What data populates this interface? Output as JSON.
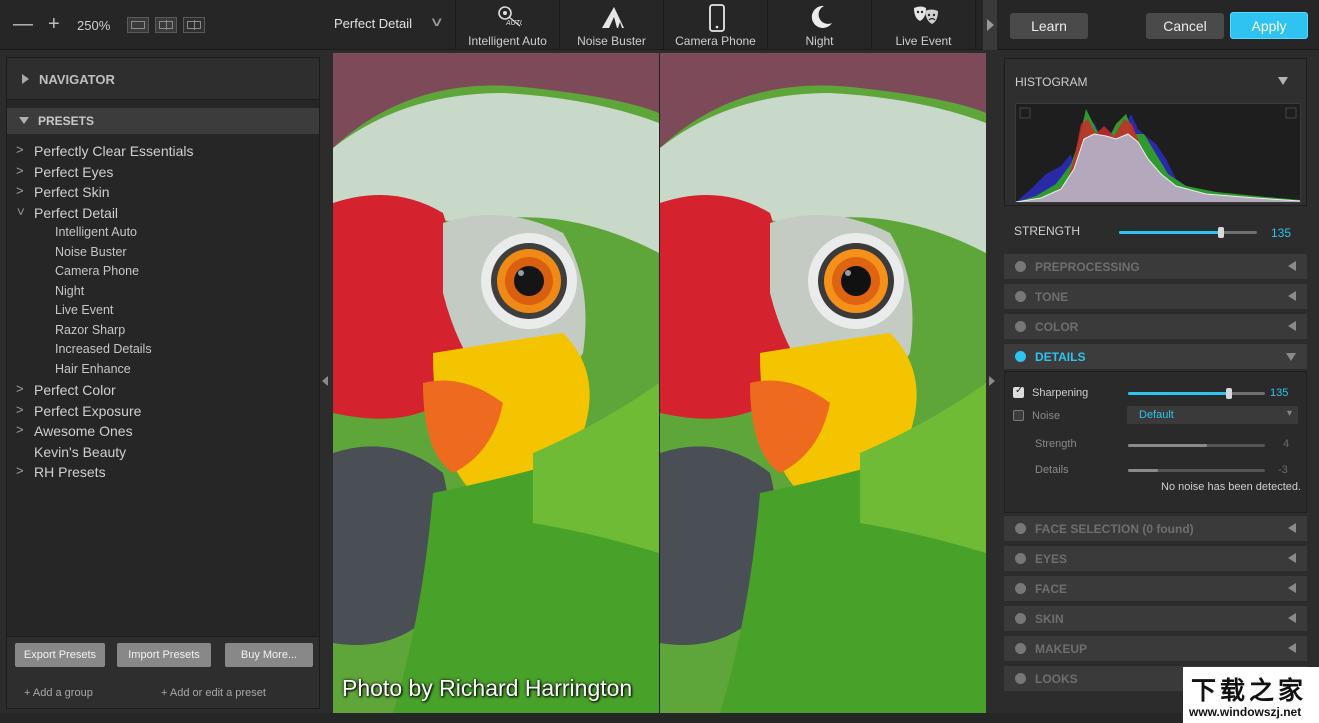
{
  "toolbar": {
    "zoom_minus": "—",
    "zoom_plus": "+",
    "zoom_level": "250%",
    "preset_name": "Perfect Detail",
    "quick_presets": [
      {
        "label": "Intelligent Auto",
        "icon": "intelligent-auto-icon"
      },
      {
        "label": "Noise Buster",
        "icon": "noise-buster-icon"
      },
      {
        "label": "Camera Phone",
        "icon": "camera-phone-icon"
      },
      {
        "label": "Night",
        "icon": "moon-icon"
      },
      {
        "label": "Live Event",
        "icon": "theater-masks-icon"
      }
    ],
    "learn": "Learn",
    "cancel": "Cancel",
    "apply": "Apply",
    "accent": "#2ec3f0"
  },
  "left": {
    "navigator": "NAVIGATOR",
    "presets": "PRESETS",
    "groups": [
      {
        "label": "Perfectly Clear Essentials",
        "expanded": false
      },
      {
        "label": "Perfect Eyes",
        "expanded": false
      },
      {
        "label": "Perfect Skin",
        "expanded": false
      },
      {
        "label": "Perfect Detail",
        "expanded": true
      }
    ],
    "sub_items": [
      "Intelligent Auto",
      "Noise Buster",
      "Camera Phone",
      "Night",
      "Live Event",
      "Razor Sharp",
      "Increased Details",
      "Hair Enhance"
    ],
    "groups_after": [
      {
        "label": "Perfect Color",
        "chevron": true
      },
      {
        "label": "Perfect Exposure",
        "chevron": true
      },
      {
        "label": "Awesome Ones",
        "chevron": true
      },
      {
        "label": "Kevin's Beauty",
        "chevron": false
      },
      {
        "label": "RH Presets",
        "chevron": true
      }
    ],
    "export": "Export Presets",
    "import": "Import Presets",
    "buy": "Buy More...",
    "add_group": "+ Add a group",
    "add_preset": "+ Add or edit a preset"
  },
  "canvas": {
    "credit": "Photo by Richard Harrington"
  },
  "right": {
    "histogram": "HISTOGRAM",
    "strength_label": "STRENGTH",
    "strength_value": "135",
    "strength_fraction": 0.74,
    "sections_top": [
      "PREPROCESSING",
      "TONE",
      "COLOR"
    ],
    "details": "DETAILS",
    "sharpening_label": "Sharpening",
    "sharpening_value": "135",
    "sharpening_fraction": 0.74,
    "noise_label": "Noise",
    "noise_select": "Default",
    "strength2_label": "Strength",
    "strength2_value": "4",
    "strength2_fraction": 0.58,
    "details2_label": "Details",
    "details2_value": "-3",
    "details2_fraction": 0.22,
    "noise_message": "No noise has been detected.",
    "sections_bottom": [
      "FACE SELECTION (0 found)",
      "EYES",
      "FACE",
      "SKIN",
      "MAKEUP",
      "LOOKS"
    ]
  },
  "watermark": {
    "chars": "下载之家",
    "url": "www.windowszj.net"
  }
}
